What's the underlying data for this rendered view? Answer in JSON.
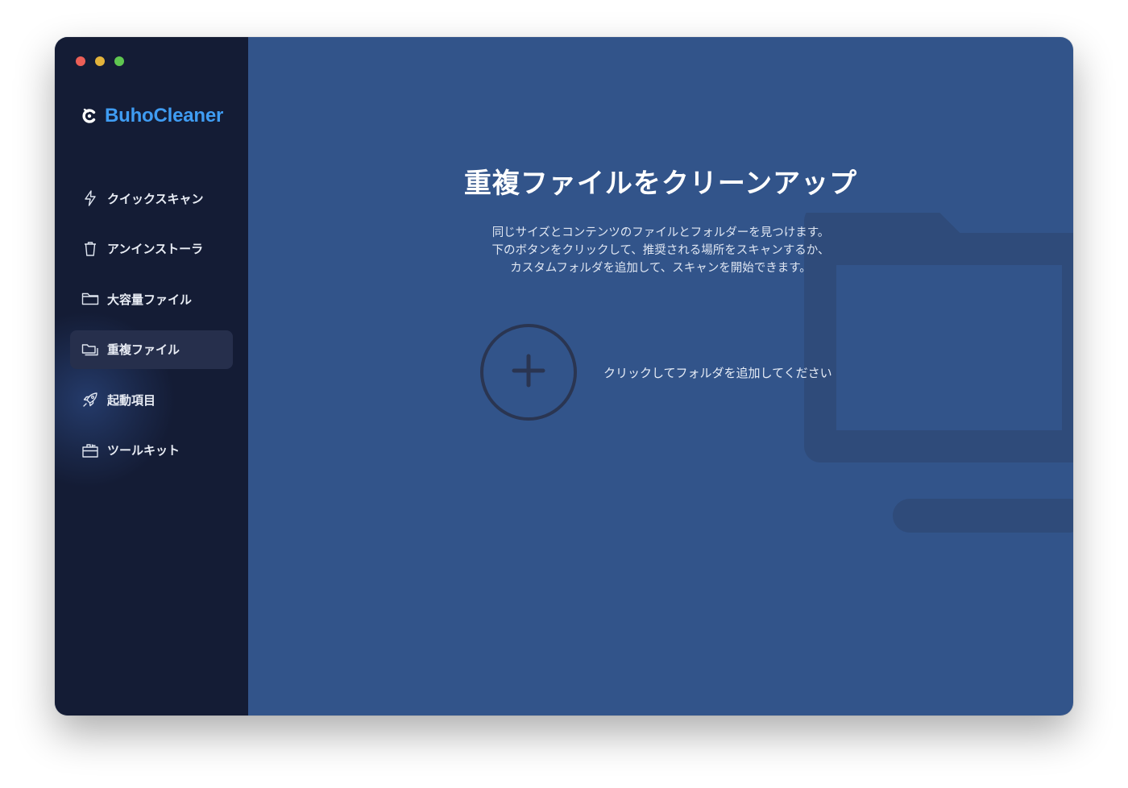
{
  "app": {
    "brand_name": "BuhoCleaner",
    "accent_color": "#3f9cf2",
    "sidebar_color": "#141c35",
    "main_color": "#32548a"
  },
  "sidebar": {
    "items": [
      {
        "label": "クイックスキャン",
        "icon": "lightning-icon",
        "active": false
      },
      {
        "label": "アンインストーラ",
        "icon": "trash-icon",
        "active": false
      },
      {
        "label": "大容量ファイル",
        "icon": "folder-icon",
        "active": false
      },
      {
        "label": "重複ファイル",
        "icon": "duplicate-folder-icon",
        "active": true
      },
      {
        "label": "起動項目",
        "icon": "rocket-icon",
        "active": false
      },
      {
        "label": "ツールキット",
        "icon": "toolbox-icon",
        "active": false
      }
    ]
  },
  "main": {
    "title": "重複ファイルをクリーンアップ",
    "description": [
      "同じサイズとコンテンツのファイルとフォルダーを見つけます。",
      "下のボタンをクリックして、推奨される場所をスキャンするか、",
      "カスタムフォルダを追加して、スキャンを開始できます。"
    ],
    "add_folder_label": "クリックしてフォルダを追加してください"
  }
}
